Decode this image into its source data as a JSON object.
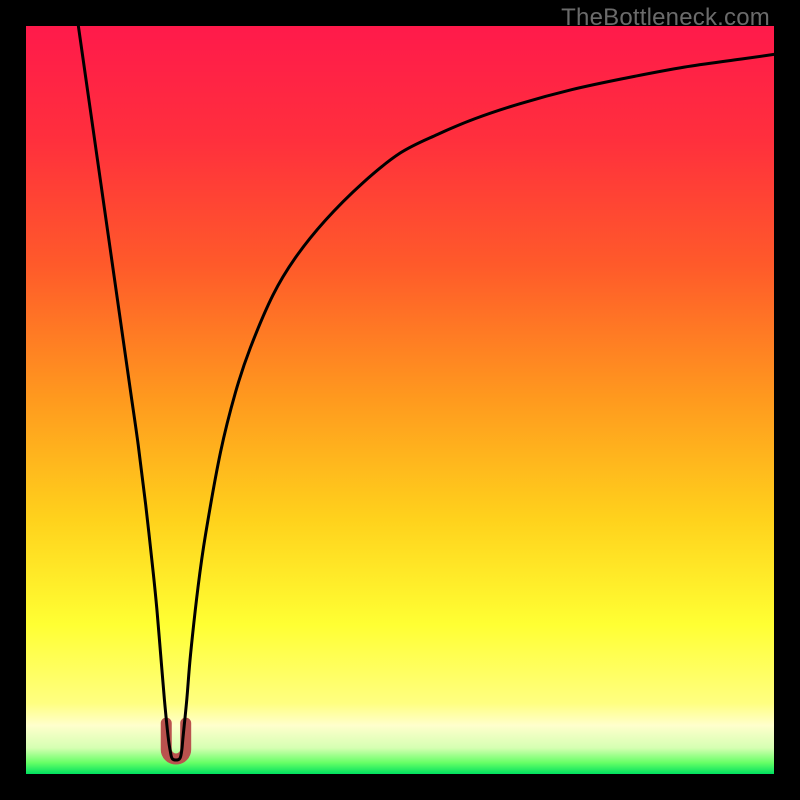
{
  "watermark": "TheBottleneck.com",
  "colors": {
    "bg": "#000000",
    "gradient_stops": [
      {
        "offset": 0.0,
        "color": "#ff1a4b"
      },
      {
        "offset": 0.15,
        "color": "#ff2f3d"
      },
      {
        "offset": 0.32,
        "color": "#ff5a2a"
      },
      {
        "offset": 0.5,
        "color": "#ff9a1e"
      },
      {
        "offset": 0.66,
        "color": "#ffd21c"
      },
      {
        "offset": 0.8,
        "color": "#ffff33"
      },
      {
        "offset": 0.905,
        "color": "#ffff80"
      },
      {
        "offset": 0.935,
        "color": "#ffffcc"
      },
      {
        "offset": 0.965,
        "color": "#d6ffb3"
      },
      {
        "offset": 0.985,
        "color": "#66ff66"
      },
      {
        "offset": 1.0,
        "color": "#00e060"
      }
    ],
    "curve": "#000000",
    "marker": "#b9524e"
  },
  "chart_data": {
    "type": "line",
    "title": "",
    "xlabel": "",
    "ylabel": "",
    "xlim": [
      0,
      100
    ],
    "ylim": [
      0,
      100
    ],
    "series": [
      {
        "name": "bottleneck-curve",
        "x": [
          7,
          8,
          9,
          10,
          11,
          12,
          13,
          14,
          15,
          16,
          17,
          17.5,
          18,
          18.5,
          19,
          19.3,
          19.6,
          20.5,
          20.8,
          21,
          21.5,
          22,
          23,
          24,
          26,
          28,
          30,
          33,
          36,
          40,
          45,
          50,
          55,
          60,
          66,
          73,
          80,
          88,
          95,
          100
        ],
        "y": [
          100,
          93,
          86,
          79,
          72,
          65,
          58,
          51,
          44,
          36,
          27,
          22,
          16,
          10,
          5,
          3,
          2,
          2,
          3,
          5,
          10,
          16,
          25,
          32,
          43,
          51,
          57,
          64,
          69,
          74,
          79,
          83,
          85.5,
          87.6,
          89.6,
          91.5,
          93,
          94.5,
          95.5,
          96.2
        ]
      }
    ],
    "marker": {
      "x_center": 20.05,
      "y": 2.0,
      "width": 2.6,
      "height": 4.8
    }
  }
}
